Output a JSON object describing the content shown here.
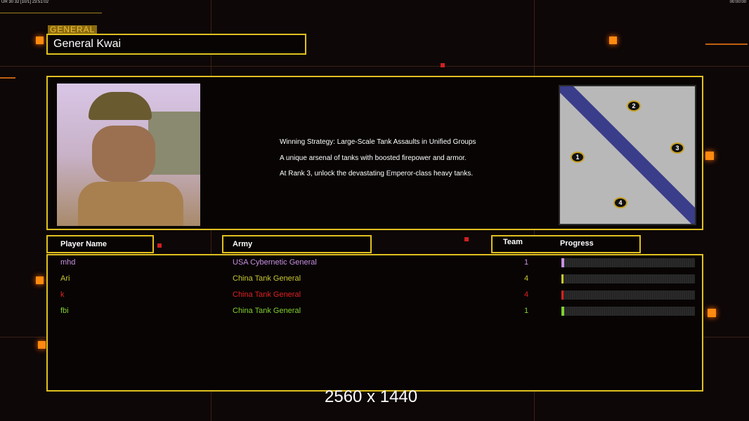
{
  "hud": {
    "left_status": "UR 30 32 [10/1] 23:51:02",
    "right_clock": "00:00:00"
  },
  "general": {
    "tag": "GENERAL",
    "name": "General Kwai"
  },
  "description": [
    "Winning Strategy: Large-Scale Tank Assaults in Unified Groups",
    "A unique arsenal of tanks with boosted firepower and armor.",
    "At Rank 3, unlock the devastating Emperor-class heavy tanks."
  ],
  "minimap": {
    "starts": [
      "1",
      "2",
      "3",
      "4"
    ]
  },
  "columns": {
    "player": "Player Name",
    "army": "Army",
    "team": "Team",
    "progress": "Progress"
  },
  "players": [
    {
      "name": "mhd",
      "army": "USA Cybernetic General",
      "team": "1",
      "progress": 2,
      "color": "#c890e0"
    },
    {
      "name": "Ari",
      "army": "China Tank General",
      "team": "4",
      "progress": 1,
      "color": "#c8c830"
    },
    {
      "name": "k",
      "army": "China Tank General",
      "team": "4",
      "progress": 1,
      "color": "#e02020"
    },
    {
      "name": "fbi",
      "army": "China Tank General",
      "team": "1",
      "progress": 2,
      "color": "#80d030"
    }
  ],
  "resolution": "2560 x 1440"
}
